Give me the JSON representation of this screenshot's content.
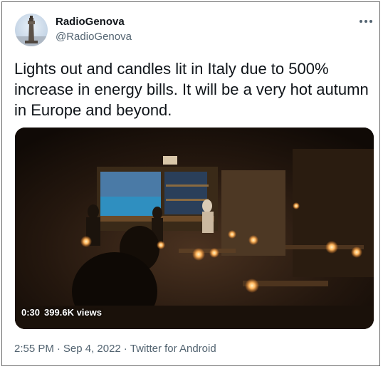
{
  "author": {
    "display_name": "RadioGenova",
    "handle": "@RadioGenova",
    "avatar_icon": "lighthouse-avatar-icon"
  },
  "more_icon": "more-horizontal-icon",
  "tweet": {
    "text": "Lights out and candles lit in Italy due to 500% increase in energy bills. It will be a very hot autumn in Europe and beyond."
  },
  "video": {
    "duration": "0:30",
    "views": "399.6K views"
  },
  "meta": {
    "time": "2:55 PM",
    "separator1": "·",
    "date": "Sep 4, 2022",
    "separator2": "·",
    "source": "Twitter for Android"
  },
  "colors": {
    "text_primary": "#0f1419",
    "text_secondary": "#536471",
    "card_border": "#6a6a6a"
  }
}
